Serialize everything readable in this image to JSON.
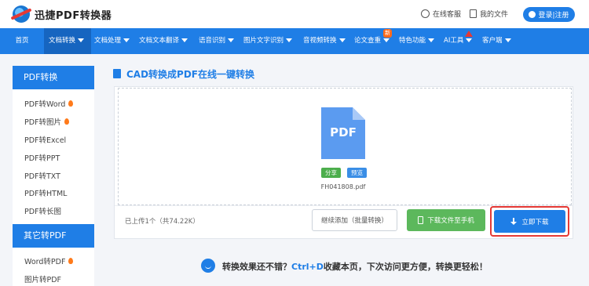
{
  "header": {
    "brand": "迅捷PDF转换器",
    "service_link": "在线客服",
    "files_link": "我的文件",
    "login_label": "登录|注册"
  },
  "nav": {
    "items": [
      "首页",
      "文档转换",
      "文档处理",
      "文档文本翻译",
      "语音识别",
      "图片文字识别",
      "音视频转换",
      "论文查重",
      "特色功能",
      "AI工具",
      "客户端"
    ],
    "active_index": 1,
    "new_badge": "新"
  },
  "sidebar": {
    "section1_title": "PDF转换",
    "section1_items": [
      "PDF转Word",
      "PDF转图片",
      "PDF转Excel",
      "PDF转PPT",
      "PDF转TXT",
      "PDF转HTML",
      "PDF转长图"
    ],
    "section2_title": "其它转PDF",
    "section2_items": [
      "Word转PDF",
      "图片转PDF"
    ]
  },
  "main": {
    "page_title": "CAD转换成PDF在线一键转换",
    "file_type_label": "PDF",
    "share_tag": "分享",
    "preview_tag": "预览",
    "filename": "FH041808.pdf",
    "upload_info": "已上传1个（共74.22K）",
    "continue_button": "继续添加（批量转换）",
    "phone_button": "下载文件至手机",
    "download_button": "立即下载"
  },
  "promo": {
    "text_before": "转换效果还不错？",
    "shortcut": "Ctrl+D",
    "text_after": "收藏本页，下次访问更方便，转换更轻松！"
  },
  "colors": {
    "primary": "#1f7ee6",
    "green": "#5cb85c",
    "highlight_red": "#e53935",
    "share_tag": "#4cae4c",
    "preview_tag": "#3a8ee6"
  }
}
